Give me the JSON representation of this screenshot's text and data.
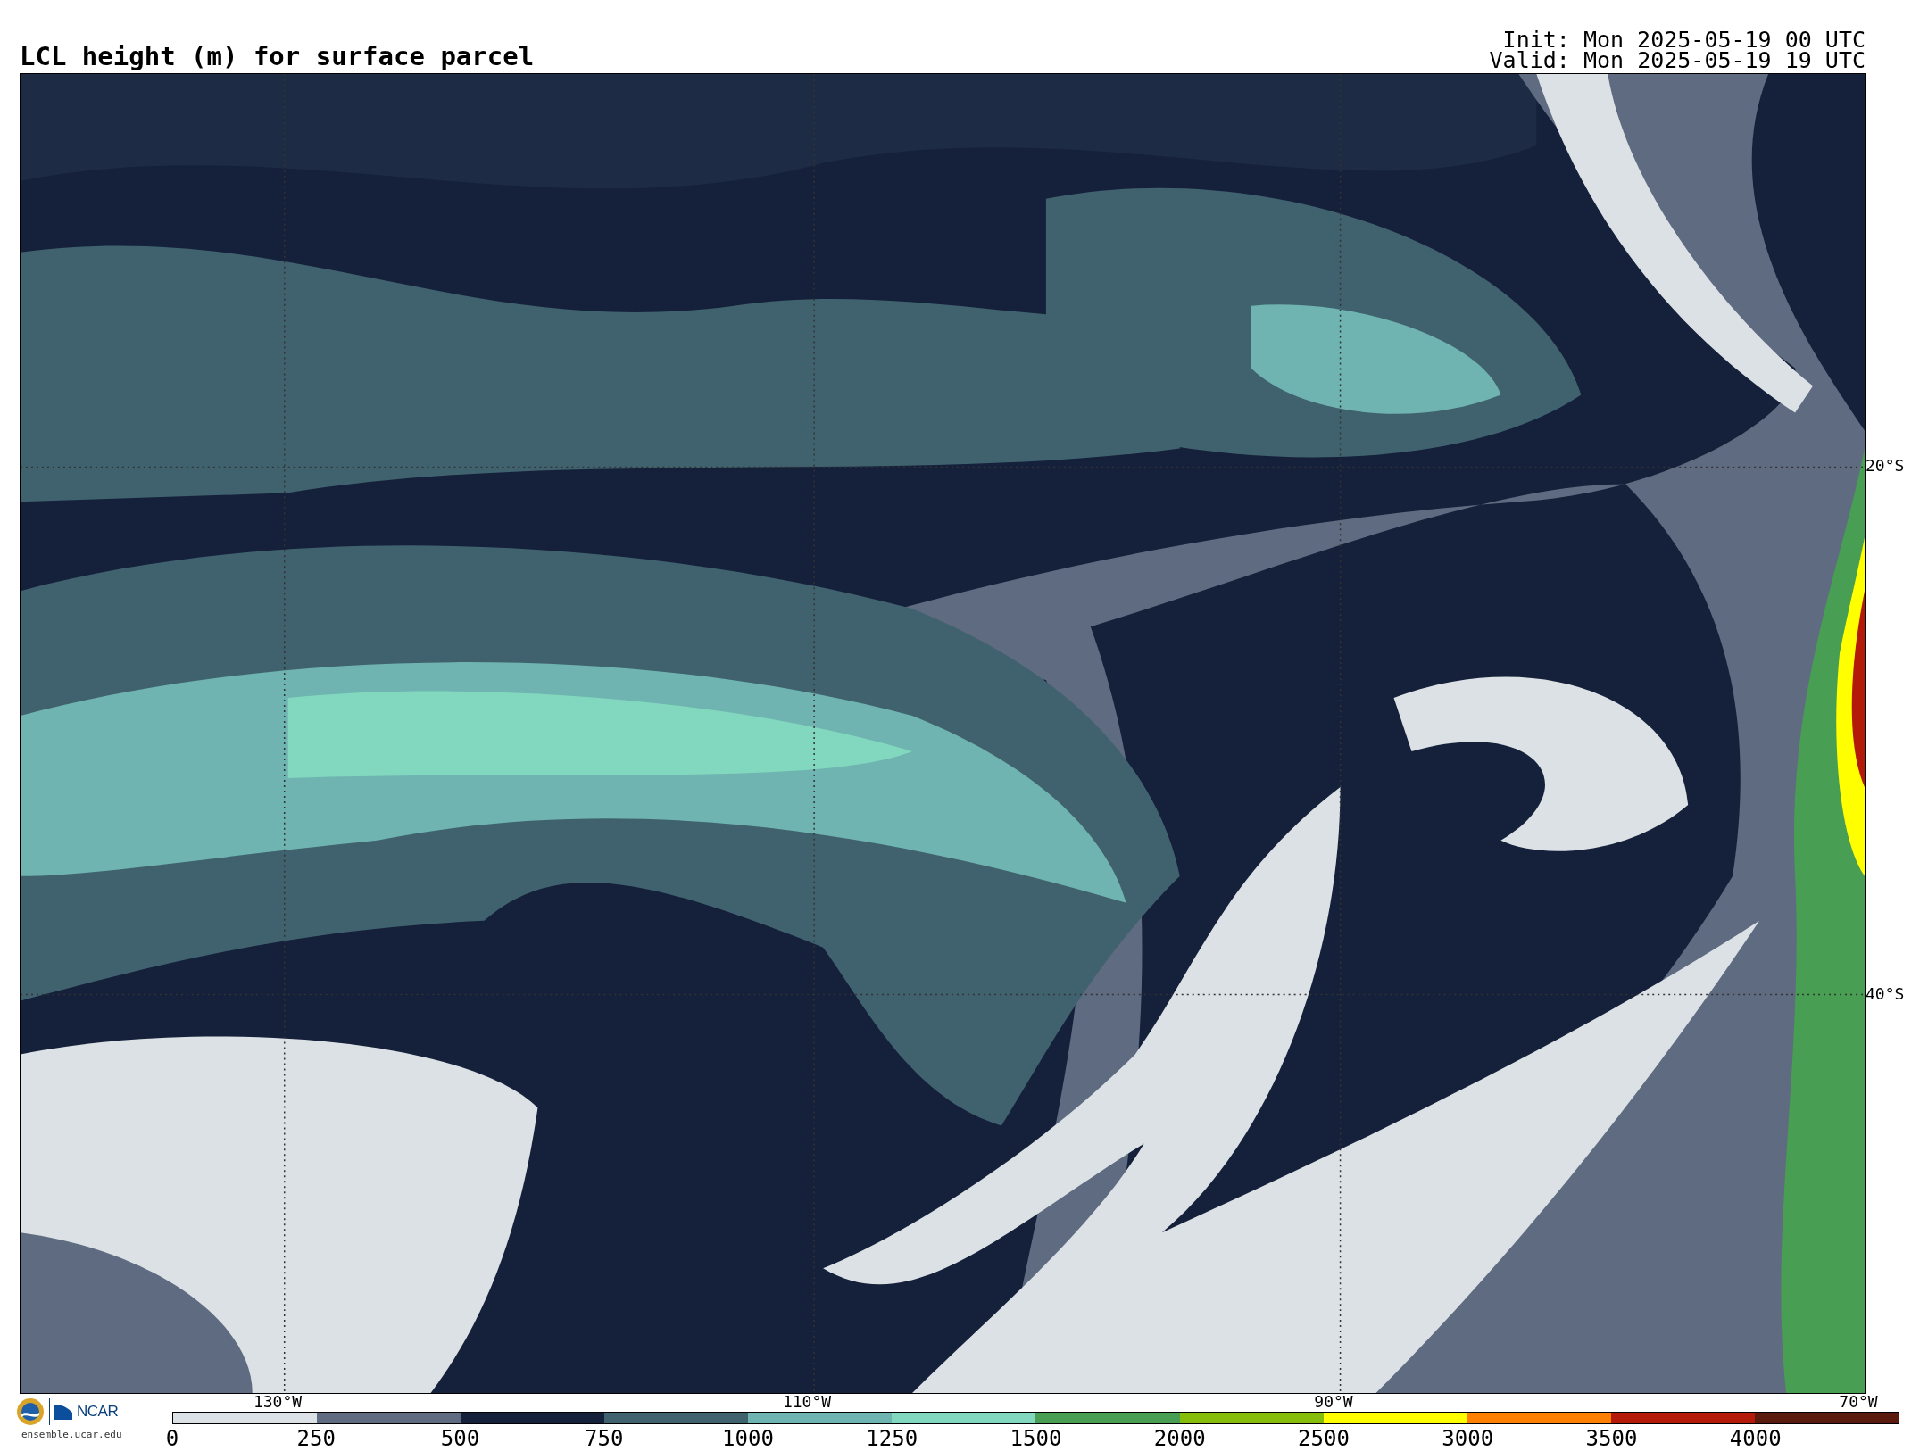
{
  "header": {
    "title": "LCL height (m) for surface parcel",
    "init": "Init: Mon 2025-05-19 00 UTC",
    "valid": "Valid: Mon 2025-05-19 19 UTC"
  },
  "map": {
    "latitude_labels": [
      "20°S",
      "40°S"
    ],
    "longitude_labels": [
      "130°W",
      "110°W",
      "90°W",
      "70°W"
    ]
  },
  "colorbar": {
    "segments": [
      {
        "from": "0",
        "color": "#dce1e6"
      },
      {
        "from": "250",
        "color": "#5f6b80"
      },
      {
        "from": "500",
        "color": "#15213a"
      },
      {
        "from": "750",
        "color": "#40626f"
      },
      {
        "from": "1000",
        "color": "#6fb4b0"
      },
      {
        "from": "1250",
        "color": "#82d8be"
      },
      {
        "from": "1500",
        "color": "#489e52"
      },
      {
        "from": "2000",
        "color": "#85bd0a"
      },
      {
        "from": "2500",
        "color": "#ffff00"
      },
      {
        "from": "3000",
        "color": "#ff8000"
      },
      {
        "from": "3500",
        "color": "#b41a0a"
      },
      {
        "from": "4000",
        "color": "#5a1a0e"
      }
    ]
  },
  "footer": {
    "logo_text": "NCAR",
    "url": "ensemble.ucar.edu"
  }
}
